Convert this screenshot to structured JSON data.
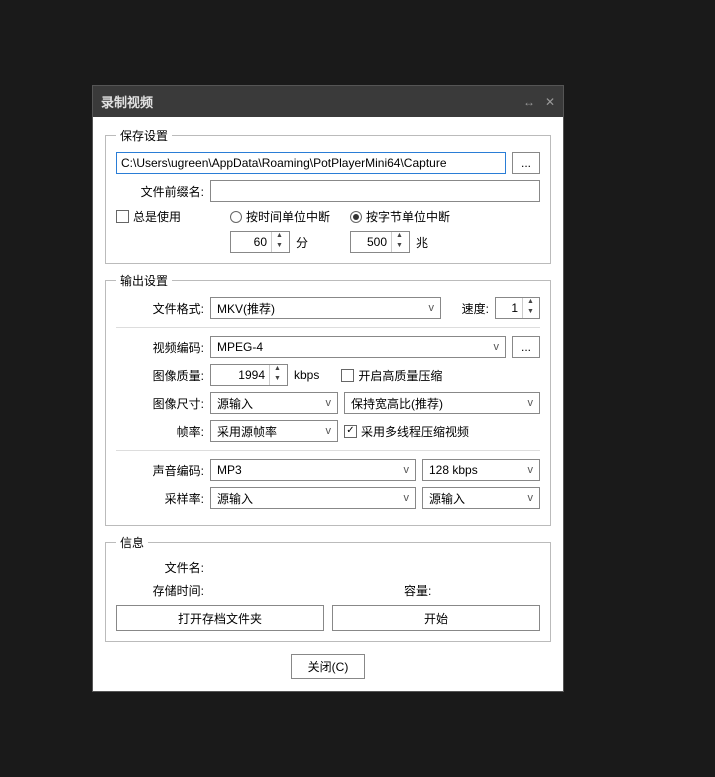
{
  "titlebar": {
    "title": "录制视频"
  },
  "save": {
    "legend": "保存设置",
    "path": "C:\\Users\\ugreen\\AppData\\Roaming\\PotPlayerMini64\\Capture",
    "browse": "...",
    "prefix_label": "文件前缀名:",
    "prefix_value": "",
    "always_use": "总是使用",
    "break_time": "按时间单位中断",
    "break_bytes": "按字节单位中断",
    "minutes_value": "60",
    "minutes_unit": "分",
    "mb_value": "500",
    "mb_unit": "兆"
  },
  "output": {
    "legend": "输出设置",
    "file_format_label": "文件格式:",
    "file_format": "MKV(推荐)",
    "speed_label": "速度:",
    "speed_value": "1",
    "video_codec_label": "视频编码:",
    "video_codec": "MPEG-4",
    "codec_opts": "...",
    "image_quality_label": "图像质量:",
    "image_quality": "1994",
    "kbps": "kbps",
    "hq_compress": "开启高质量压缩",
    "image_size_label": "图像尺寸:",
    "image_size": "源输入",
    "aspect": "保持宽高比(推荐)",
    "fps_label": "帧率:",
    "fps": "采用源帧率",
    "multithread": "采用多线程压缩视频",
    "audio_codec_label": "声音编码:",
    "audio_codec": "MP3",
    "audio_bitrate": "128 kbps",
    "sample_rate_label": "采样率:",
    "sample_rate": "源输入",
    "channels": "源输入"
  },
  "info": {
    "legend": "信息",
    "filename_label": "文件名:",
    "duration_label": "存储时间:",
    "capacity_label": "容量:",
    "open_folder": "打开存档文件夹",
    "start": "开始"
  },
  "close": "关闭(C)"
}
